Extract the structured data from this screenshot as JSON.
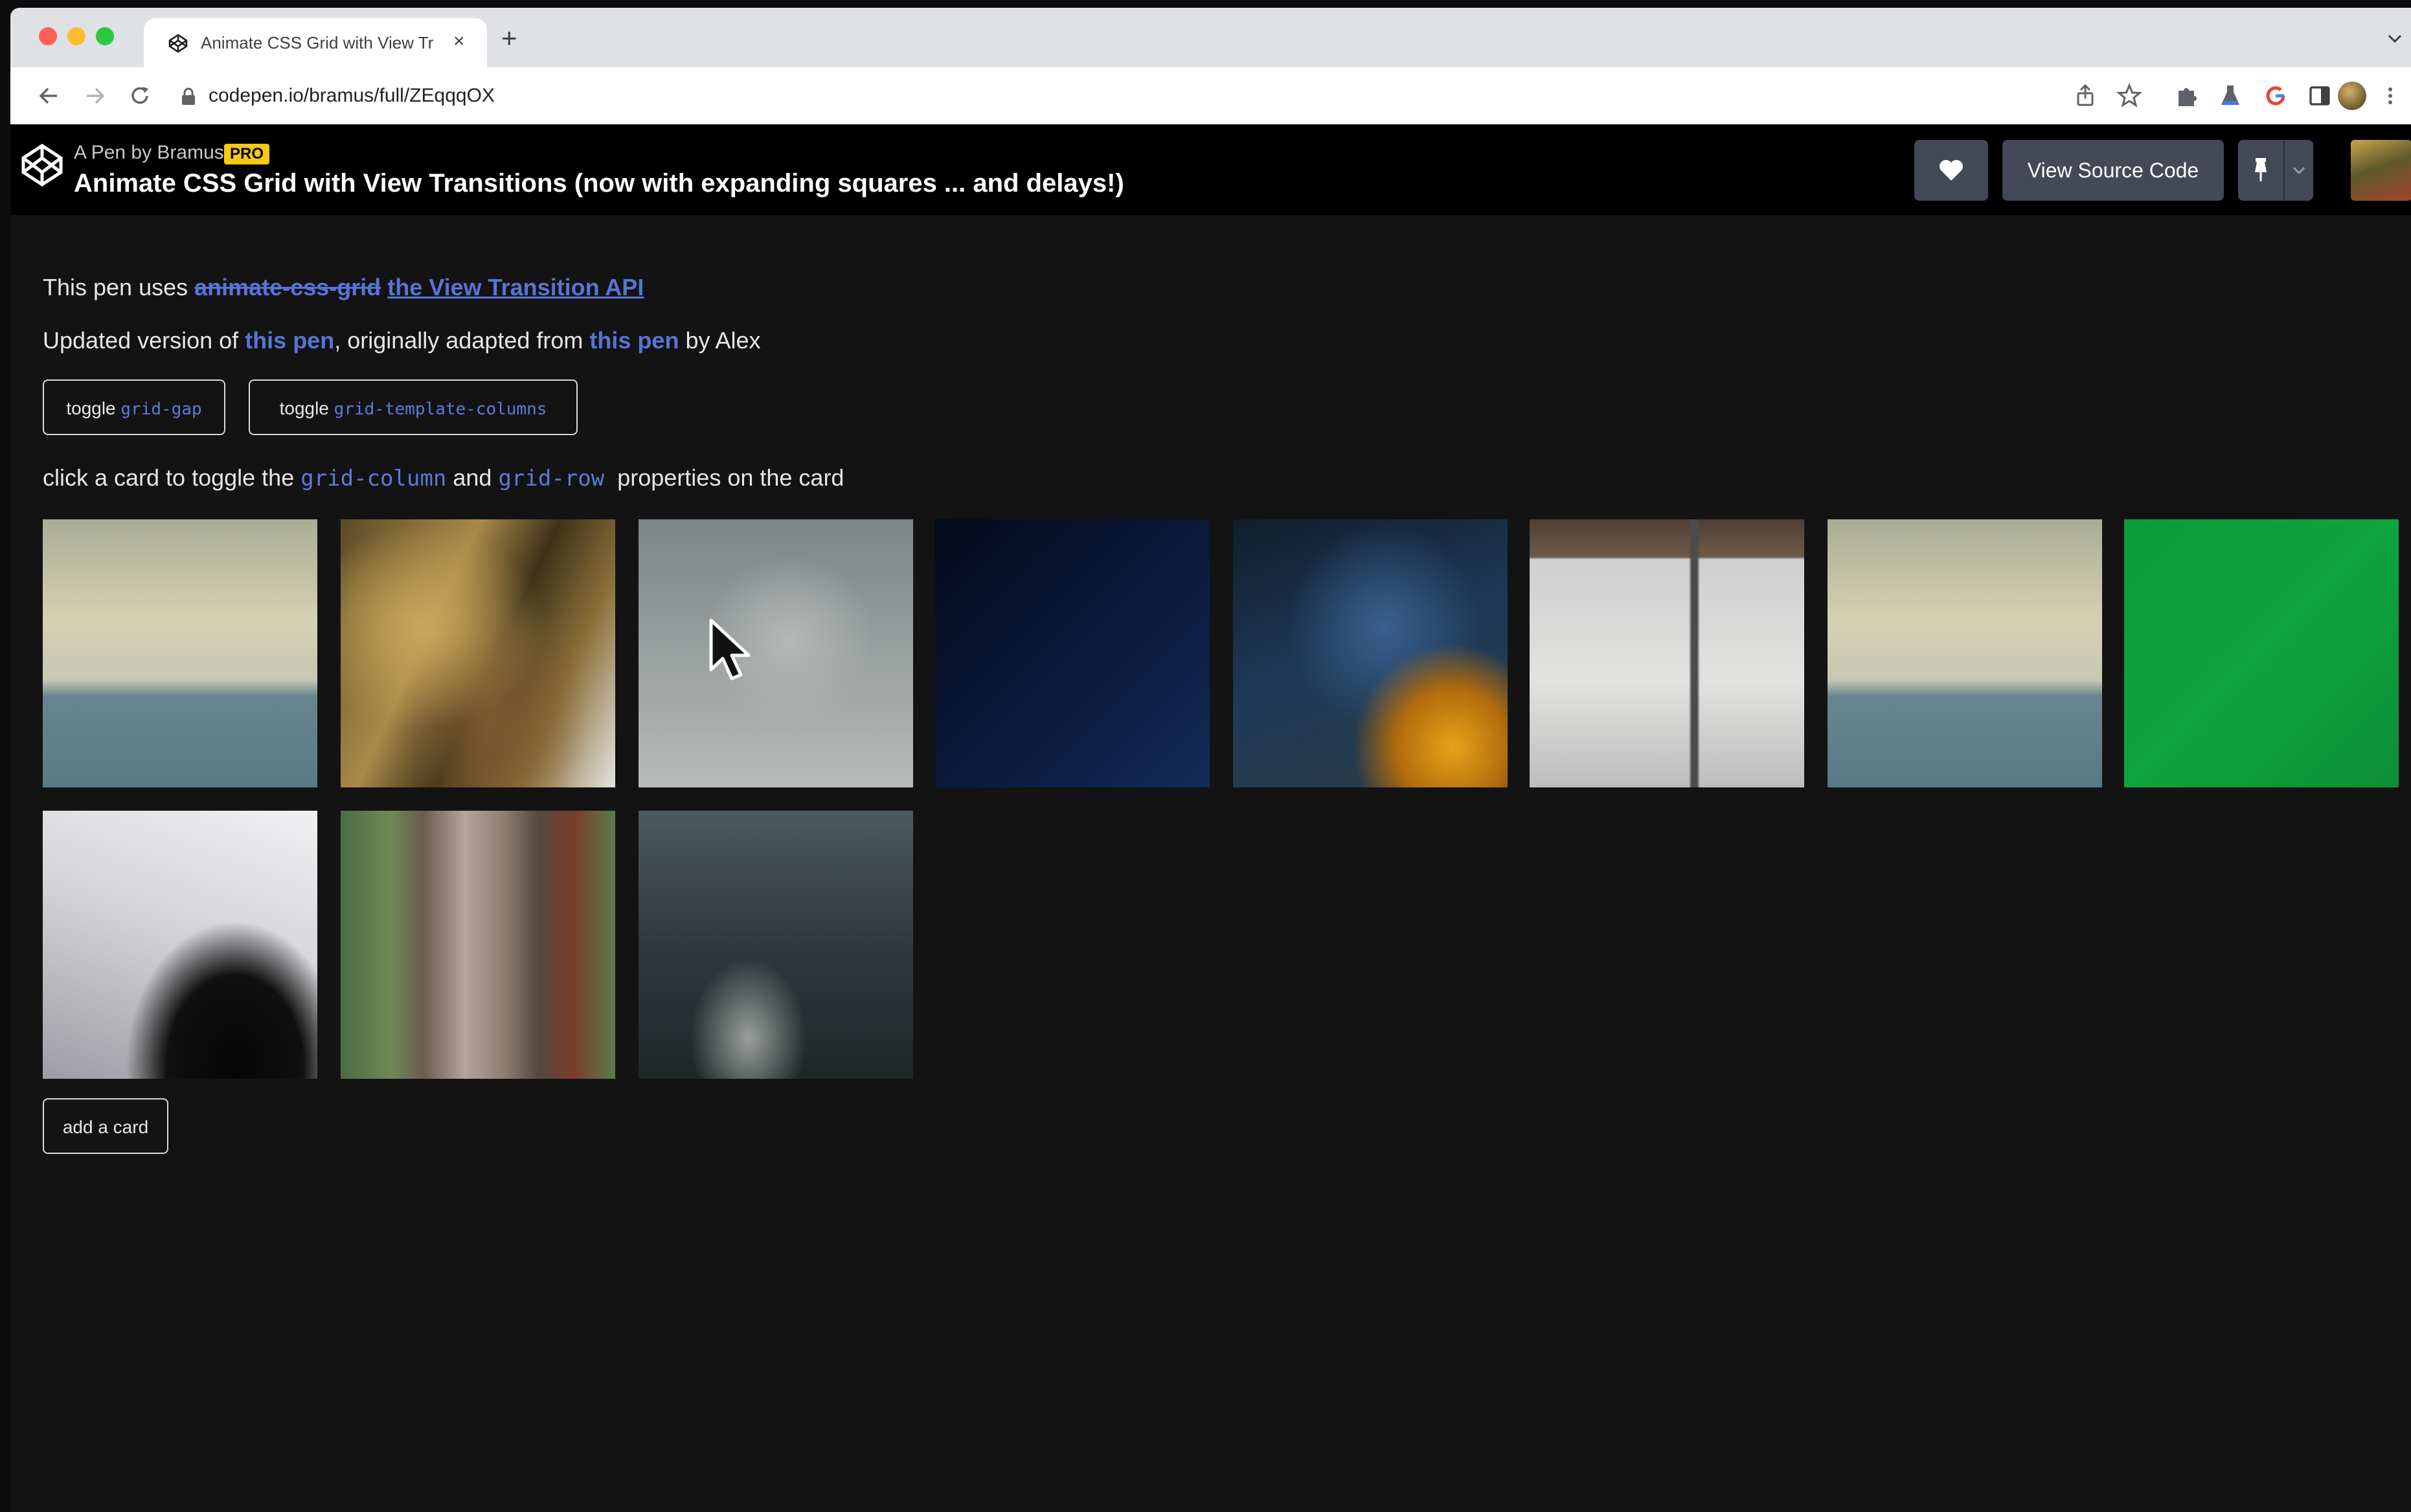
{
  "browser": {
    "tab": {
      "title": "Animate CSS Grid with View Tr",
      "close": "×"
    },
    "new_tab": "+",
    "url": "codepen.io/bramus/full/ZEqqqOX"
  },
  "header": {
    "byline": "A Pen by Bramus",
    "pro_badge": "PRO",
    "title": "Animate CSS Grid with View Transitions (now with expanding squares ... and delays!)",
    "view_source_label": "View Source Code"
  },
  "intro": {
    "uses_prefix": "This pen uses ",
    "old_link": "animate-css-grid",
    "new_link": "the View Transition API",
    "updated_prefix": "Updated version of ",
    "this_pen_1": "this pen",
    "originally": ", originally adapted from ",
    "this_pen_2": "this pen",
    "by_alex": " by Alex"
  },
  "controls": {
    "toggle_word": "toggle",
    "gap_code": "grid-gap",
    "cols_code": "grid-template-columns",
    "add_card": "add a card"
  },
  "instruction": {
    "prefix": "click a card to toggle the ",
    "code1": "grid-column",
    "and": " and ",
    "code2": "grid-row",
    "suffix": "  properties on the card"
  },
  "cards": [
    {
      "name": "card-sea-horizon-1"
    },
    {
      "name": "card-palm-tree"
    },
    {
      "name": "card-cloudy-sky"
    },
    {
      "name": "card-dark-blue"
    },
    {
      "name": "card-yellow-car"
    },
    {
      "name": "card-white-truck"
    },
    {
      "name": "card-sea-horizon-2"
    },
    {
      "name": "card-green"
    },
    {
      "name": "card-white-surface"
    },
    {
      "name": "card-tree-bark"
    },
    {
      "name": "card-dark-blur"
    }
  ]
}
